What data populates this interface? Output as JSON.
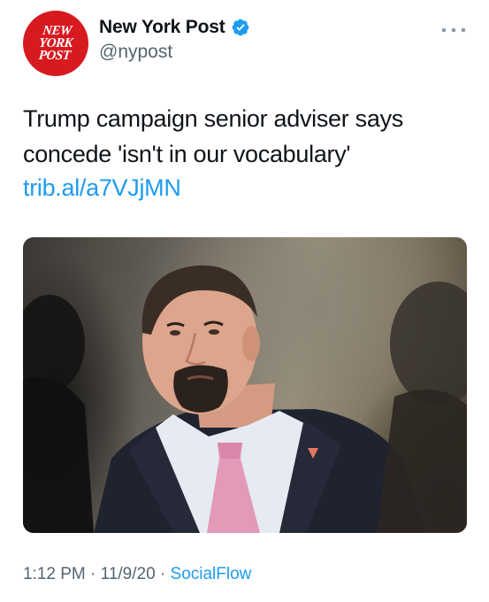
{
  "account": {
    "avatar_logo_lines": [
      "NEW",
      "YORK",
      "POST"
    ],
    "display_name": "New York Post",
    "handle": "@nypost",
    "verified": true,
    "verified_icon": "verified-badge-icon",
    "more_icon": "more-options-icon"
  },
  "tweet": {
    "text": "Trump campaign senior adviser says concede 'isn't in our vocabulary'",
    "link": "trib.al/a7VJjMN",
    "media_icon": "photo-of-man-in-suit"
  },
  "footer": {
    "time": "1:12 PM",
    "separator": " · ",
    "date": "11/9/20",
    "source": "SocialFlow"
  },
  "colors": {
    "brand_red": "#d71920",
    "link_blue": "#1d9bf0",
    "secondary_text": "#536471",
    "primary_text": "#0f1419"
  }
}
